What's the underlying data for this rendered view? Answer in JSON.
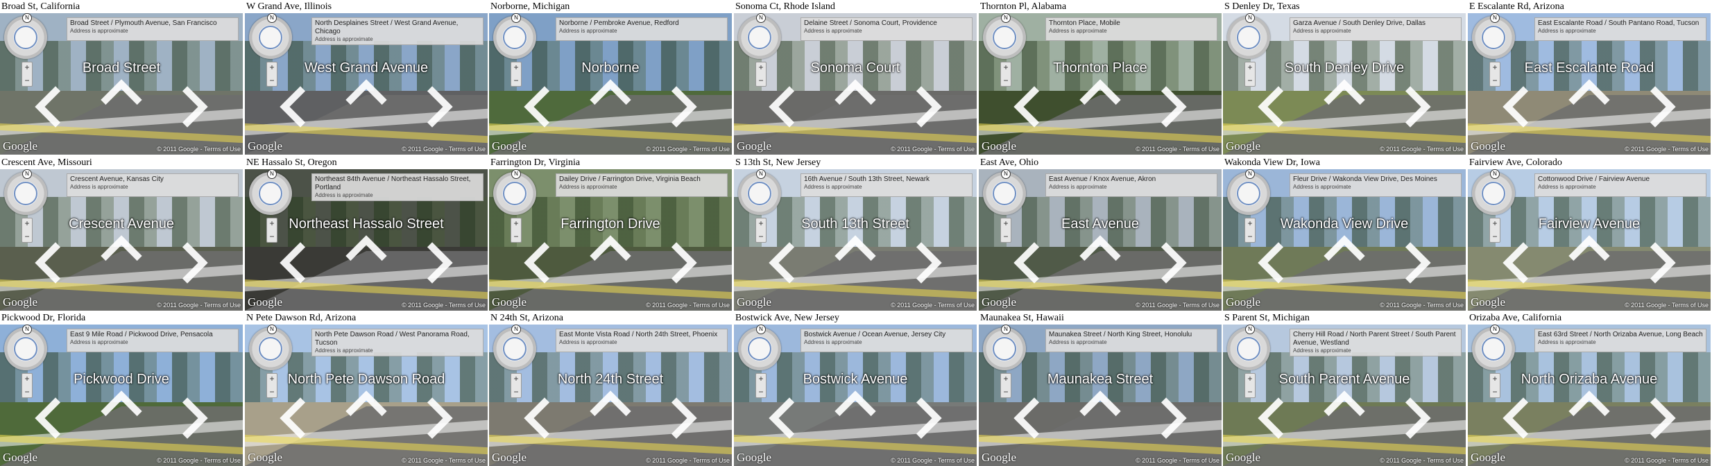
{
  "copyright": "© 2011 Google",
  "terms_link": "Terms of Use",
  "google_logo": "Google",
  "address_note": "Address is approximate",
  "compass_letter": "N",
  "zoom_plus": "+",
  "zoom_minus": "−",
  "tiles": [
    {
      "title": "Broad St, California",
      "address": "Broad Street / Plymouth Avenue, San Francisco",
      "street": "Broad Street",
      "sky": "#9fb2c4",
      "ground": "#6f7468"
    },
    {
      "title": "W Grand Ave, Illinois",
      "address": "North Desplaines Street / West Grand Avenue, Chicago",
      "street": "West Grand Avenue",
      "sky": "#8aa6c8",
      "ground": "#5f6062"
    },
    {
      "title": "Norborne, Michigan",
      "address": "Norborne / Pembroke Avenue, Redford",
      "street": "Norborne",
      "sky": "#7fa0c6",
      "ground": "#4f6a3c"
    },
    {
      "title": "Sonoma Ct, Rhode Island",
      "address": "Delaine Street / Sonoma Court, Providence",
      "street": "Sonoma Court",
      "sky": "#c9ced6",
      "ground": "#6a6a68"
    },
    {
      "title": "Thornton Pl, Alabama",
      "address": "Thornton Place, Mobile",
      "street": "Thornton Place",
      "sky": "#9fb0a2",
      "ground": "#3f4f2e"
    },
    {
      "title": "S Denley Dr, Texas",
      "address": "Garza Avenue / South Denley Drive, Dallas",
      "street": "South Denley Drive",
      "sky": "#d4dbe4",
      "ground": "#7c8a55"
    },
    {
      "title": "E Escalante Rd, Arizona",
      "address": "East Escalante Road / South Pantano Road, Tucson",
      "street": "East Escalante Road",
      "sky": "#9fbbe0",
      "ground": "#8f8a76"
    },
    {
      "title": "Crescent Ave, Missouri",
      "address": "Crescent Avenue, Kansas City",
      "street": "Crescent Avenue",
      "sky": "#bfc8d2",
      "ground": "#5a5f4e"
    },
    {
      "title": "NE Hassalo St, Oregon",
      "address": "Northeast 84th Avenue / Northeast Hassalo Street, Portland",
      "street": "Northeast Hassalo Street",
      "sky": "#4c5248",
      "ground": "#3a3a36"
    },
    {
      "title": "Farrington Dr, Virginia",
      "address": "Dailey Drive / Farrington Drive, Virginia Beach",
      "street": "Farrington Drive",
      "sky": "#7c8f6c",
      "ground": "#4e5a3e"
    },
    {
      "title": "S 13th St, New Jersey",
      "address": "16th Avenue / South 13th Street, Newark",
      "street": "South 13th Street",
      "sky": "#c6d2e0",
      "ground": "#7a7c72"
    },
    {
      "title": "East Ave, Ohio",
      "address": "East Avenue / Knox Avenue, Akron",
      "street": "East Avenue",
      "sky": "#a9b3bd",
      "ground": "#505a48"
    },
    {
      "title": "Wakonda View Dr, Iowa",
      "address": "Fleur Drive / Wakonda View Drive, Des Moines",
      "street": "Wakonda View Drive",
      "sky": "#9bb6d8",
      "ground": "#6f7a58"
    },
    {
      "title": "Fairview Ave, Colorado",
      "address": "Cottonwood Drive / Fairview Avenue",
      "street": "Fairview Avenue",
      "sky": "#b7cce4",
      "ground": "#858a70"
    },
    {
      "title": "Pickwood Dr, Florida",
      "address": "East 9 Mile Road / Pickwood Drive, Pensacola",
      "street": "Pickwood Drive",
      "sky": "#8eb0d8",
      "ground": "#4f6a3a"
    },
    {
      "title": "N Pete Dawson Rd, Arizona",
      "address": "North Pete Dawson Road / West Panorama Road, Tucson",
      "street": "North Pete Dawson Road",
      "sky": "#a8c3e4",
      "ground": "#a8a08a"
    },
    {
      "title": "N 24th St, Arizona",
      "address": "East Monte Vista Road / North 24th Street, Phoenix",
      "street": "North 24th Street",
      "sky": "#a3bde0",
      "ground": "#7d7a70"
    },
    {
      "title": "Bostwick Ave, New Jersey",
      "address": "Bostwick Avenue / Ocean Avenue, Jersey City",
      "street": "Bostwick Avenue",
      "sky": "#9cb8dc",
      "ground": "#777a78"
    },
    {
      "title": "Maunakea St, Hawaii",
      "address": "Maunakea Street / North King Street, Honolulu",
      "street": "Maunakea Street",
      "sky": "#8ea7c4",
      "ground": "#6b6b68"
    },
    {
      "title": "S Parent St, Michigan",
      "address": "Cherry Hill Road / North Parent Street / South Parent Avenue, Westland",
      "street": "South Parent Avenue",
      "sky": "#b6c8de",
      "ground": "#6e7a55"
    },
    {
      "title": "Orizaba Ave, California",
      "address": "East 63rd Street / North Orizaba Avenue, Long Beach",
      "street": "North Orizaba Avenue",
      "sky": "#a9c2de",
      "ground": "#7a8060"
    }
  ]
}
